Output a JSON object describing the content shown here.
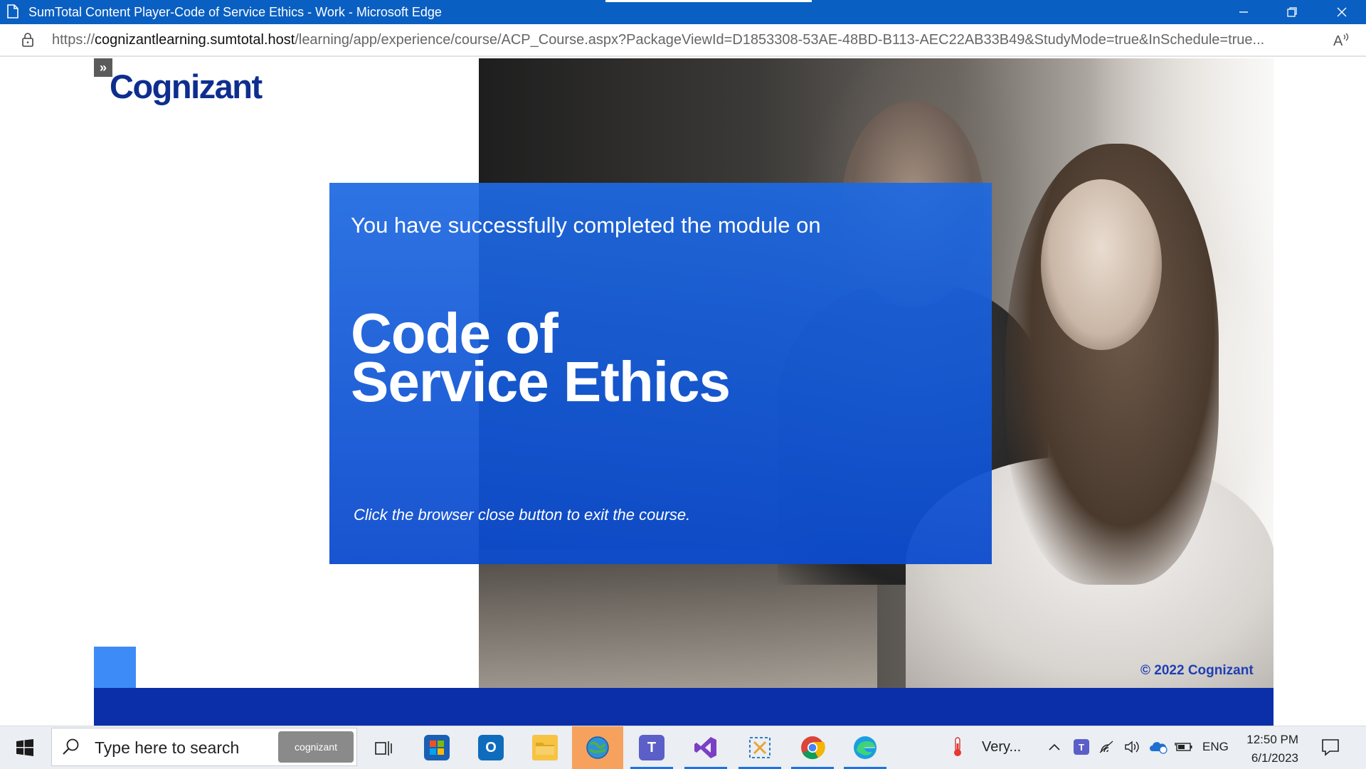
{
  "window": {
    "title": "SumTotal Content Player-Code of Service Ethics - Work - Microsoft Edge",
    "controls": [
      "minimize-icon",
      "restore-icon",
      "close-icon"
    ]
  },
  "address_bar": {
    "url_scheme": "https://",
    "url_host": "cognizantlearning.sumtotal.host",
    "url_path": "/learning/app/experience/course/ACP_Course.aspx?PackageViewId=D1853308-53AE-48BD-B113-AEC22AB33B49&StudyMode=true&InSchedule=true..."
  },
  "course": {
    "sidebar_toggle": "»",
    "logo_text": "Cognizant",
    "completion_message": "You have successfully completed the module on",
    "title_line1": "Code of",
    "title_line2": "Service Ethics",
    "instruction": "Click the browser close button to exit the course.",
    "copyright": "© 2022 Cognizant",
    "colors": {
      "panel_blue": "#1e69e1",
      "bottom_bar": "#0a2fa8",
      "accent_square": "#3d8bf7",
      "logo_navy": "#0e2e8f"
    }
  },
  "taskbar": {
    "search_placeholder": "Type here to search",
    "search_highlight": "cognizant",
    "apps": [
      {
        "name": "task-view-icon"
      },
      {
        "name": "microsoft-store-icon"
      },
      {
        "name": "outlook-icon"
      },
      {
        "name": "file-explorer-icon"
      },
      {
        "name": "network-globe-icon",
        "active": true
      },
      {
        "name": "teams-icon"
      },
      {
        "name": "visual-studio-icon"
      },
      {
        "name": "snipping-tool-icon"
      },
      {
        "name": "chrome-icon"
      },
      {
        "name": "edge-icon"
      }
    ],
    "weather": "Very...",
    "language": "ENG",
    "time": "12:50 PM",
    "date": "6/1/2023"
  }
}
